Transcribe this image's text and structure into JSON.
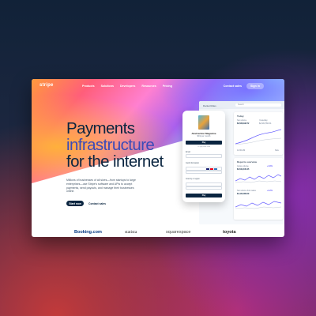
{
  "nav": {
    "logo": "stripe",
    "links": [
      "Products",
      "Solutions",
      "Developers",
      "Resources",
      "Pricing"
    ],
    "contact": "Contact sales",
    "signin": "Sign in"
  },
  "hero": {
    "headline_line1": "Payments",
    "headline_line2": "infrastructure",
    "headline_line3": "for the internet",
    "description": "Millions of businesses of all sizes—from startups to large enterprises—use Stripe's software and APIs to accept payments, send payouts, and manage their businesses online.",
    "cta_primary": "Start now",
    "cta_secondary": "Contact sales"
  },
  "logos": [
    "Booking.com",
    "statista",
    "squarespace",
    "toyota"
  ],
  "phone": {
    "product_name": "Abstraction Magazine",
    "product_price": "$19 per month",
    "pay_button": "Pay",
    "or_text": "Or pay with card",
    "email_label": "Email",
    "card_label": "Card information",
    "country_label": "Country or region",
    "submit_button": "Pay"
  },
  "dashboard": {
    "account": "Rocket Rides",
    "search_placeholder": "Search",
    "today_title": "Today",
    "net_volume_label": "Net volume",
    "net_volume_value": "$3,528,198.72",
    "yesterday_label": "Yesterday",
    "yesterday_value": "$2,931,556.34",
    "time_left": "12:00 AM",
    "time_right": "Now",
    "reports_title": "Reports overview",
    "gross_label": "Gross volume",
    "gross_value": "$4,542,345.45",
    "gross_change": "+4.6%",
    "net_label": "Net volume from sales",
    "net_value": "$4,123,489.09",
    "net_change": "+3.2%"
  },
  "colors": {
    "navy": "#0a2540",
    "accent": "#635bff",
    "headline_accent": "#3b4ab8"
  }
}
